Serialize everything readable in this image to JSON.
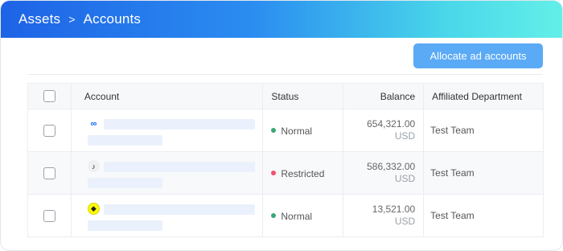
{
  "breadcrumb": {
    "root": "Assets",
    "separator": ">",
    "current": "Accounts"
  },
  "toolbar": {
    "allocate_label": "Allocate ad accounts"
  },
  "table": {
    "headers": {
      "account": "Account",
      "status": "Status",
      "balance": "Balance",
      "department": "Affiliated Department"
    },
    "rows": [
      {
        "platform_icon": "meta-icon",
        "status": "Normal",
        "status_color": "#3aa676",
        "balance": "654,321.00",
        "currency": "USD",
        "department": "Test Team"
      },
      {
        "platform_icon": "tiktok-icon",
        "status": "Restricted",
        "status_color": "#f0506e",
        "balance": "586,332.00",
        "currency": "USD",
        "department": "Test Team"
      },
      {
        "platform_icon": "snapchat-icon",
        "status": "Normal",
        "status_color": "#3aa676",
        "balance": "13,521.00",
        "currency": "USD",
        "department": "Test Team"
      }
    ]
  },
  "colors": {
    "header_gradient_start": "#1e63e6",
    "header_gradient_end": "#63efe8",
    "button": "#5aaaf5"
  }
}
